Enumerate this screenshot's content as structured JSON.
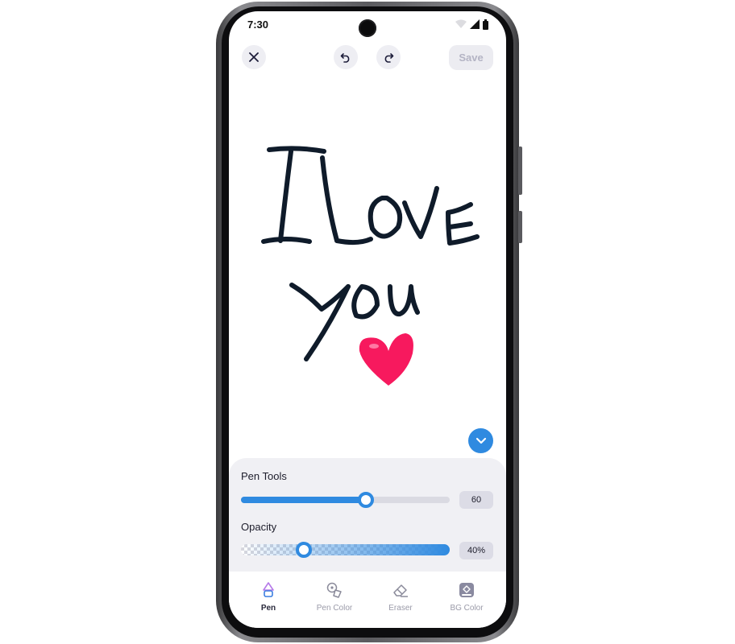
{
  "status_bar": {
    "time": "7:30"
  },
  "toolbar": {
    "save_label": "Save"
  },
  "drawing": {
    "ink_color": "#0f1b2a",
    "heart_color": "#f7195e"
  },
  "pen_tools": {
    "label": "Pen Tools",
    "value": "60",
    "level": 0.6
  },
  "opacity": {
    "label": "Opacity",
    "value": "40%",
    "level": 0.3
  },
  "accent_color": "#2f8ae0",
  "bottom_nav": [
    {
      "label": "Pen",
      "icon": "pen-icon",
      "active": true
    },
    {
      "label": "Pen Color",
      "icon": "palette-icon",
      "active": false
    },
    {
      "label": "Eraser",
      "icon": "eraser-icon",
      "active": false
    },
    {
      "label": "BG Color",
      "icon": "paint-bucket-icon",
      "active": false
    }
  ]
}
